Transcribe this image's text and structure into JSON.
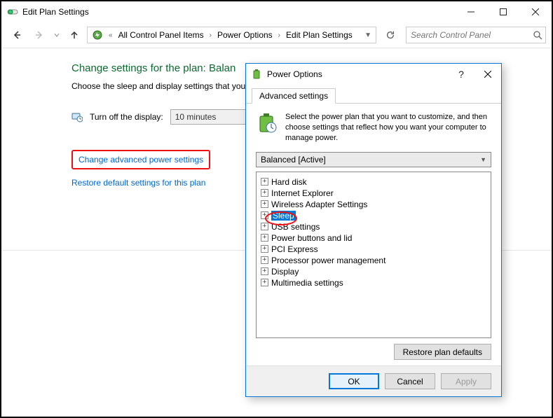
{
  "window": {
    "title": "Edit Plan Settings"
  },
  "breadcrumb": {
    "items": [
      "All Control Panel Items",
      "Power Options",
      "Edit Plan Settings"
    ]
  },
  "search": {
    "placeholder": "Search Control Panel"
  },
  "page": {
    "heading_prefix": "Change settings for the plan: ",
    "heading_plan": "Balan",
    "sub": "Choose the sleep and display settings that you",
    "display_label": "Turn off the display:",
    "display_value": "10 minutes",
    "link_advanced": "Change advanced power settings",
    "link_restore": "Restore default settings for this plan"
  },
  "dialog": {
    "title": "Power Options",
    "tab": "Advanced settings",
    "intro": "Select the power plan that you want to customize, and then choose settings that reflect how you want your computer to manage power.",
    "plan_selected": "Balanced [Active]",
    "tree": [
      "Hard disk",
      "Internet Explorer",
      "Wireless Adapter Settings",
      "Sleep",
      "USB settings",
      "Power buttons and lid",
      "PCI Express",
      "Processor power management",
      "Display",
      "Multimedia settings"
    ],
    "restore_btn": "Restore plan defaults",
    "ok": "OK",
    "cancel": "Cancel",
    "apply": "Apply"
  }
}
